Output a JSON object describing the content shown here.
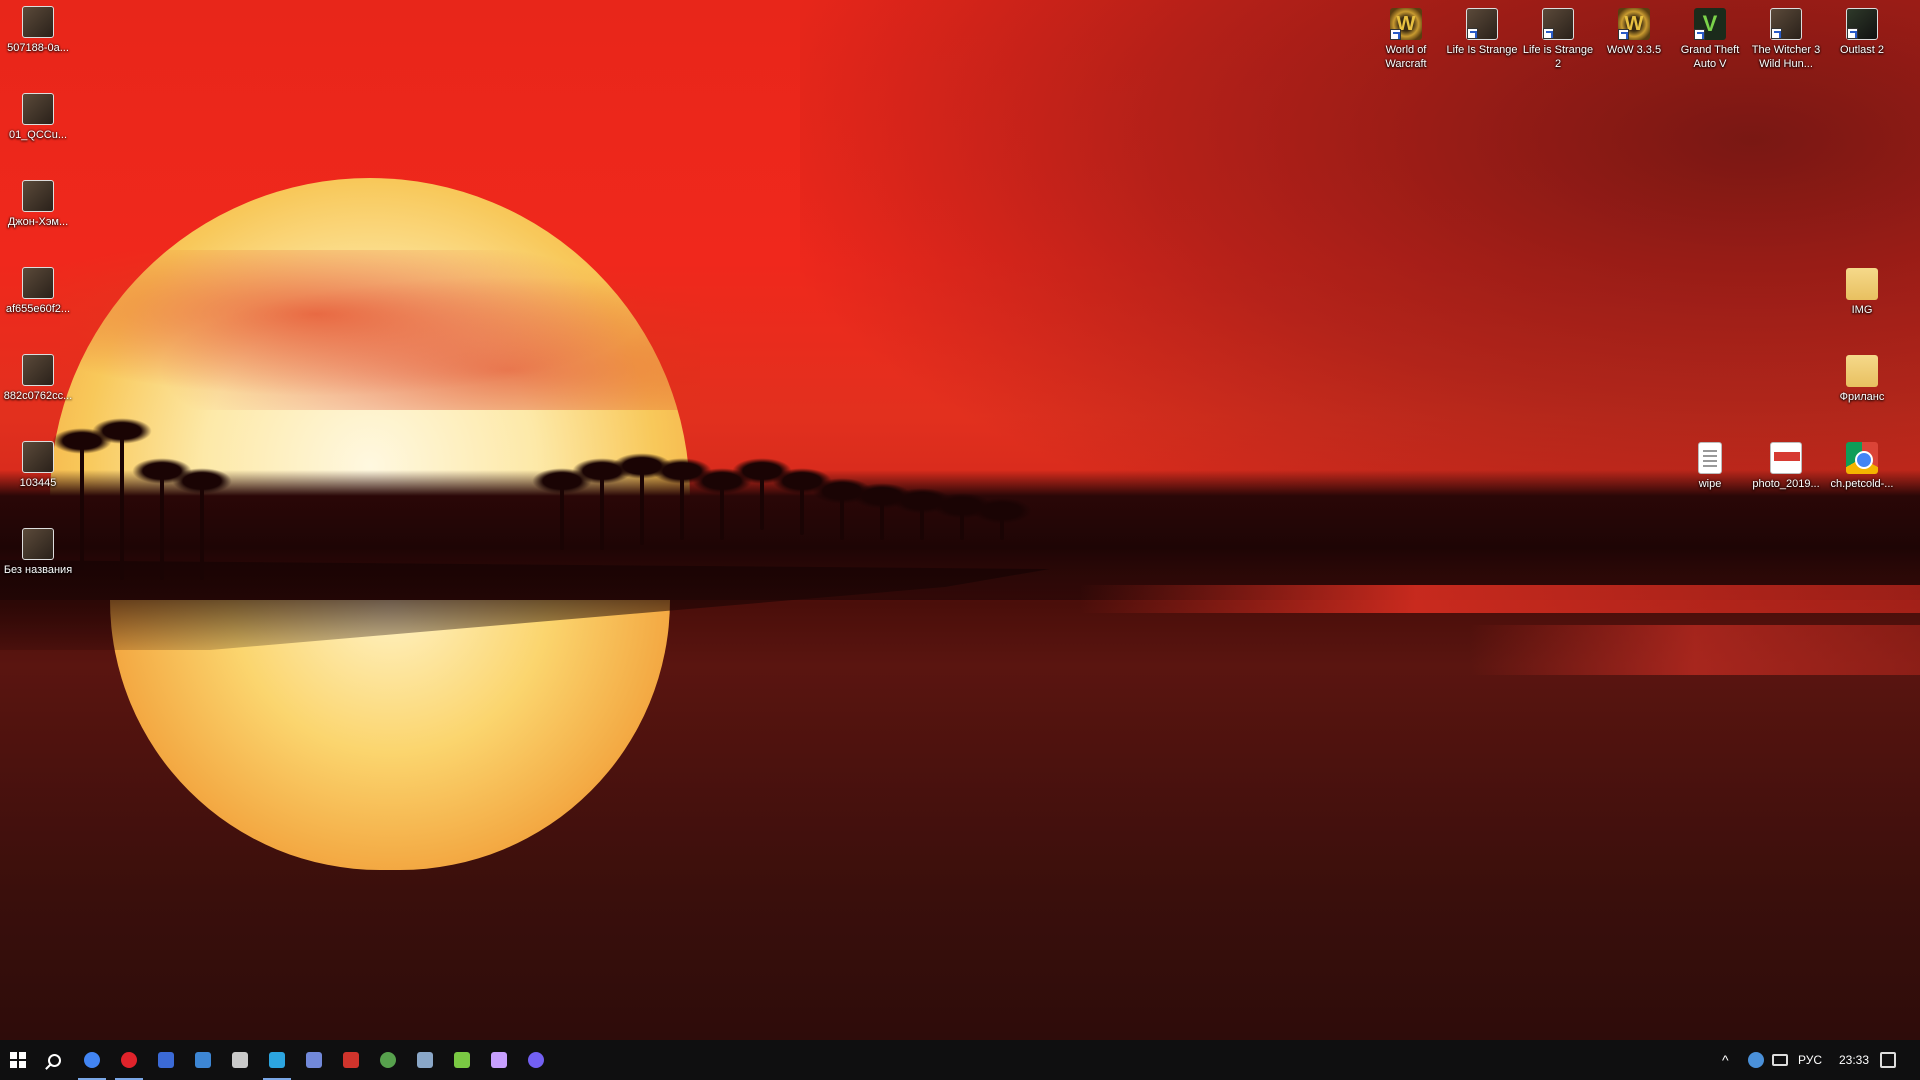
{
  "desktop": {
    "left_icons": [
      {
        "label": "507188-0a...",
        "icon": "photo-icon"
      },
      {
        "label": "01_QCCu...",
        "icon": "photo-icon"
      },
      {
        "label": "Джон-Хэм...",
        "icon": "photo-icon"
      },
      {
        "label": "af655e60f2...",
        "icon": "photo-icon"
      },
      {
        "label": "882c0762cc...",
        "icon": "photo-icon"
      },
      {
        "label": "103445",
        "icon": "photo-icon"
      },
      {
        "label": "Без названия",
        "icon": "photo-icon"
      }
    ],
    "top_icons": [
      {
        "label": "World of Warcraft",
        "icon": "wow-icon"
      },
      {
        "label": "Life Is Strange",
        "icon": "game-icon"
      },
      {
        "label": "Life is Strange 2",
        "icon": "game-icon"
      },
      {
        "label": "WoW 3.3.5",
        "icon": "wow-icon"
      },
      {
        "label": "Grand Theft Auto V",
        "icon": "gta-icon"
      },
      {
        "label": "The Witcher 3 Wild Hun...",
        "icon": "game-icon"
      },
      {
        "label": "Outlast 2",
        "icon": "game-icon"
      }
    ],
    "right_icons": [
      {
        "label": "IMG",
        "icon": "photo-folder-icon"
      },
      {
        "label": "Фриланс",
        "icon": "folder-icon"
      },
      {
        "label": "wipe",
        "icon": "text-document-icon"
      },
      {
        "label": "photo_2019...",
        "icon": "pdf-document-icon"
      },
      {
        "label": "ch.petcold-...",
        "icon": "chrome-icon"
      }
    ]
  },
  "taskbar": {
    "apps": [
      {
        "name": "start-button",
        "icon": "windows-icon"
      },
      {
        "name": "search-button",
        "icon": "search-icon"
      },
      {
        "name": "chrome",
        "icon": "chrome-icon",
        "color": "#4285f4",
        "active": true
      },
      {
        "name": "opera",
        "icon": "opera-icon",
        "color": "#e0232b",
        "active": true
      },
      {
        "name": "floppy",
        "icon": "save-icon",
        "color": "#3b6ad6"
      },
      {
        "name": "app-blue",
        "icon": "pen-icon",
        "color": "#3d86d4"
      },
      {
        "name": "app-robot",
        "icon": "robot-icon",
        "color": "#c9c9c9"
      },
      {
        "name": "telegram",
        "icon": "telegram-icon",
        "color": "#2ca5e0",
        "active": true
      },
      {
        "name": "discord",
        "icon": "discord-icon",
        "color": "#7289da"
      },
      {
        "name": "app-red",
        "icon": "download-icon",
        "color": "#d0342c"
      },
      {
        "name": "app-green",
        "icon": "globe-icon",
        "color": "#57a14d"
      },
      {
        "name": "app-box",
        "icon": "box-icon",
        "color": "#8aa7c8"
      },
      {
        "name": "app-play",
        "icon": "play-icon",
        "color": "#7ac943"
      },
      {
        "name": "app-music",
        "icon": "music-icon",
        "color": "#c8a0ff"
      },
      {
        "name": "viber",
        "icon": "viber-icon",
        "color": "#7360f2"
      }
    ],
    "tray": {
      "language": "РУС",
      "time": "23:33"
    }
  }
}
